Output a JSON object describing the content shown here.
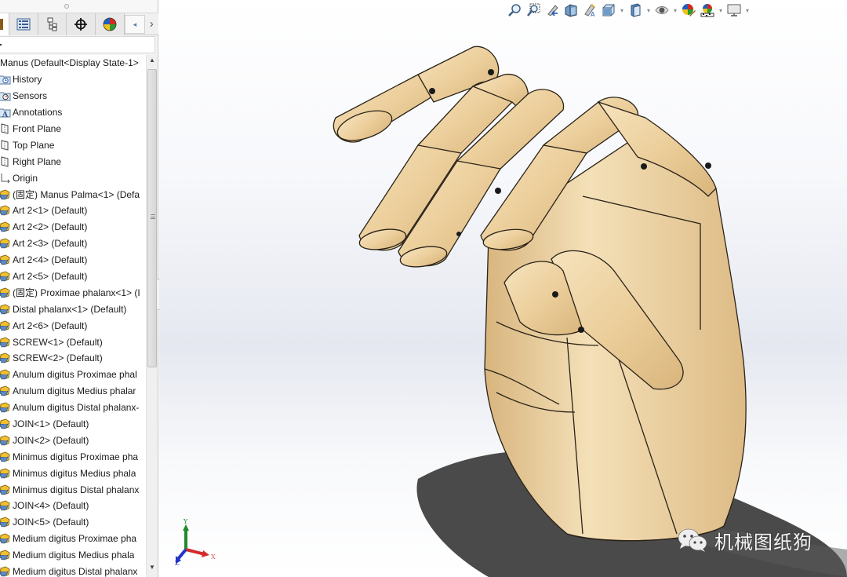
{
  "feature_manager": {
    "tabs": [
      {
        "name": "feature-tree",
        "icon": "feature-tree-icon"
      },
      {
        "name": "property-manager",
        "icon": "property-manager-icon"
      },
      {
        "name": "configuration-manager",
        "icon": "configuration-manager-icon"
      },
      {
        "name": "dimxpert-manager",
        "icon": "crosshair-icon"
      },
      {
        "name": "display-manager",
        "icon": "appearance-sphere-icon"
      }
    ],
    "tree": {
      "root": "Manus  (Default<Display State-1>",
      "items": [
        {
          "label": "History",
          "icon": "history-folder-icon"
        },
        {
          "label": "Sensors",
          "icon": "sensors-folder-icon"
        },
        {
          "label": "Annotations",
          "icon": "annotations-folder-icon"
        },
        {
          "label": "Front Plane",
          "icon": "plane-icon"
        },
        {
          "label": "Top Plane",
          "icon": "plane-icon"
        },
        {
          "label": "Right Plane",
          "icon": "plane-icon"
        },
        {
          "label": "Origin",
          "icon": "origin-icon"
        },
        {
          "label": "(固定) Manus Palma<1> (Defa",
          "icon": "part-icon"
        },
        {
          "label": "Art 2<1> (Default)",
          "icon": "part-icon"
        },
        {
          "label": "Art 2<2> (Default)",
          "icon": "part-icon"
        },
        {
          "label": "Art 2<3> (Default)",
          "icon": "part-icon"
        },
        {
          "label": "Art 2<4> (Default)",
          "icon": "part-icon"
        },
        {
          "label": "Art 2<5> (Default)",
          "icon": "part-icon"
        },
        {
          "label": "(固定) Proximae phalanx<1> (I",
          "icon": "part-icon"
        },
        {
          "label": "Distal phalanx<1> (Default)",
          "icon": "part-icon"
        },
        {
          "label": "Art 2<6> (Default)",
          "icon": "part-icon"
        },
        {
          "label": "SCREW<1> (Default)",
          "icon": "part-icon"
        },
        {
          "label": "SCREW<2> (Default)",
          "icon": "part-icon"
        },
        {
          "label": "Anulum digitus Proximae phal",
          "icon": "part-icon"
        },
        {
          "label": "Anulum digitus Medius phalar",
          "icon": "part-icon"
        },
        {
          "label": "Anulum digitus Distal phalanx-",
          "icon": "part-icon"
        },
        {
          "label": "JOIN<1> (Default)",
          "icon": "part-icon"
        },
        {
          "label": "JOIN<2> (Default)",
          "icon": "part-icon"
        },
        {
          "label": "Minimus digitus Proximae pha",
          "icon": "part-icon"
        },
        {
          "label": "Minimus digitus Medius phala",
          "icon": "part-icon"
        },
        {
          "label": "Minimus digitus Distal phalanx",
          "icon": "part-icon"
        },
        {
          "label": "JOIN<4> (Default)",
          "icon": "part-icon"
        },
        {
          "label": "JOIN<5> (Default)",
          "icon": "part-icon"
        },
        {
          "label": "Medium digitus Proximae pha",
          "icon": "part-icon"
        },
        {
          "label": "Medium digitus Medius phala",
          "icon": "part-icon"
        },
        {
          "label": "Medium digitus Distal phalanx",
          "icon": "part-icon"
        }
      ]
    }
  },
  "heads_up_toolbar": [
    {
      "name": "zoom-to-fit",
      "icon": "zoom-to-fit-icon",
      "dropdown": false
    },
    {
      "name": "zoom-to-area",
      "icon": "zoom-to-area-icon",
      "dropdown": false
    },
    {
      "name": "previous-view",
      "icon": "previous-view-icon",
      "dropdown": false
    },
    {
      "name": "section-view",
      "icon": "section-view-icon",
      "dropdown": false
    },
    {
      "name": "dynamic-annotation-views",
      "icon": "dynamic-annotation-icon",
      "dropdown": false
    },
    {
      "name": "view-orientation",
      "icon": "view-orientation-icon",
      "dropdown": true
    },
    {
      "name": "display-style",
      "icon": "display-style-icon",
      "dropdown": true
    },
    {
      "name": "hide-show-items",
      "icon": "eye-icon",
      "dropdown": true
    },
    {
      "name": "edit-appearance",
      "icon": "edit-appearance-icon",
      "dropdown": false
    },
    {
      "name": "apply-scene",
      "icon": "apply-scene-icon",
      "dropdown": true
    },
    {
      "name": "view-settings",
      "icon": "monitor-icon",
      "dropdown": true
    }
  ],
  "triad": {
    "x_label": "X",
    "y_label": "Y",
    "z_label": "Z"
  },
  "watermark": {
    "text": "机械图纸狗",
    "icon": "wechat-icon"
  },
  "colors": {
    "wood": "#ecd3a5",
    "wood_dark": "#d7b47c",
    "x_axis": "#d42a2a",
    "y_axis": "#1f8a2a",
    "z_axis": "#2035c8"
  }
}
